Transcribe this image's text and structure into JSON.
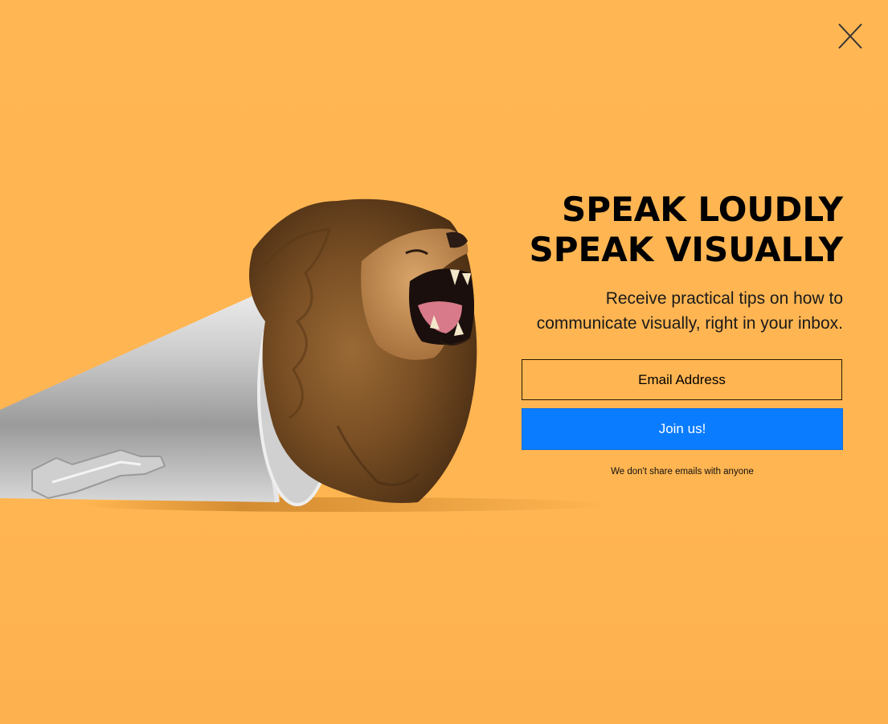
{
  "popup": {
    "background_color": "#ffb552",
    "close_icon": "close-icon",
    "headline_line1": "SPEAK LOUDLY",
    "headline_line2": "SPEAK VISUALLY",
    "subtitle_line1": "Receive practical tips on how to",
    "subtitle_line2": "communicate visually, right in your inbox.",
    "email_placeholder": "Email Address",
    "join_label": "Join us!",
    "join_color": "#0a7cff",
    "disclaimer": "We don't share emails with anyone",
    "hero_image": "lion-megaphone-image"
  }
}
